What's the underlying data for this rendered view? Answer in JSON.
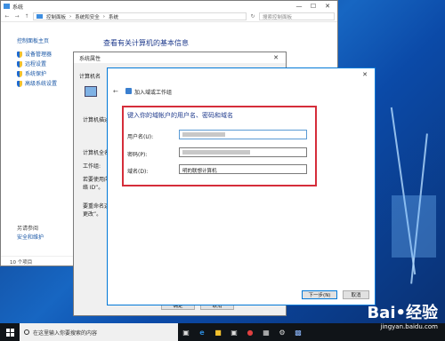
{
  "system_window": {
    "title": "系统",
    "breadcrumb": [
      "控制面板",
      "系统和安全",
      "系统"
    ],
    "search_placeholder": "搜索控制面板",
    "left_items": [
      "控制面板主页",
      "设备管理器",
      "远程设置",
      "系统保护",
      "高级系统设置"
    ],
    "see_also": "另请参阅",
    "see_also_items": [
      "安全和维护"
    ],
    "heading": "查看有关计算机的基本信息",
    "status": "10 个项目"
  },
  "properties_window": {
    "title": "系统属性",
    "tab": "计算机名",
    "labels": [
      "计算机描述",
      "计算机全名",
      "工作组:",
      "若要使用向",
      "络 ID”。",
      "要重命名这",
      "更改”。"
    ],
    "ok_label": "确定",
    "cancel_label": "取消"
  },
  "wizard": {
    "title": "加入域或工作组",
    "instruction": "键入你的域帐户的用户名、密码和域名",
    "username_label": "用户名(U):",
    "password_label": "密码(P):",
    "domain_label": "域名(D):",
    "domain_value": "明的联想计算机",
    "next_label": "下一步(N)",
    "cancel_label": "取消"
  },
  "taskbar": {
    "search_text": "在这里输入你要搜索的内容"
  },
  "watermark": {
    "brand": "Bai•经验",
    "url": "jingyan.baidu.com"
  },
  "colors": {
    "accent": "#0078d7",
    "highlight_box": "#d52d3a",
    "link": "#1a57a6"
  }
}
